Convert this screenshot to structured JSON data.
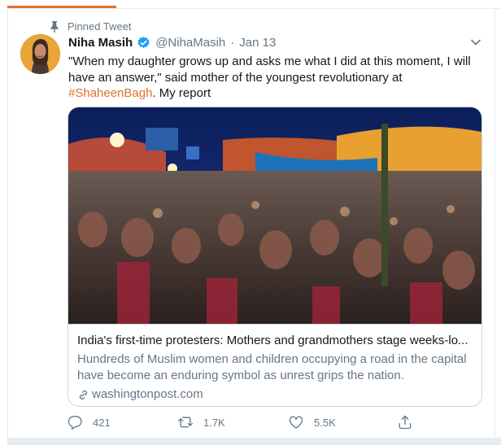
{
  "pinned_label": "Pinned Tweet",
  "author": {
    "name": "Niha Masih",
    "handle": "@NihaMasih",
    "separator": "·",
    "date": "Jan 13"
  },
  "tweet": {
    "text": "\"When my daughter grows up and asks me what I did at this moment, I will have an answer,\" said mother of the youngest revolutionary at ",
    "hashtag": "#ShaheenBagh",
    "text_after": ". My report"
  },
  "card": {
    "title": "India's first-time protesters: Mothers and grandmothers stage weeks-lo...",
    "description": "Hundreds of Muslim women and children occupying a road in the capital have become an enduring symbol as unrest grips the nation.",
    "domain": "washingtonpost.com"
  },
  "actions": {
    "replies": "421",
    "retweets": "1.7K",
    "likes": "5.5K"
  },
  "colors": {
    "accent": "#e0712f",
    "verified": "#1da1f2",
    "muted": "#657786",
    "border": "#ccd6dd"
  }
}
